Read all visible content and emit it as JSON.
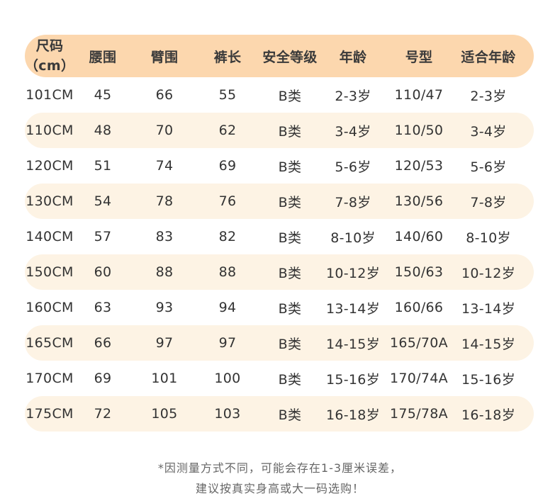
{
  "header": {
    "size_line1": "尺码",
    "size_line2": "（cm）",
    "waist": "腰围",
    "arm": "臂围",
    "pants_length": "裤长",
    "safety_level": "安全等级",
    "age": "年龄",
    "model": "号型",
    "suitable_age": "适合年龄"
  },
  "rows": [
    {
      "size": "101CM",
      "waist": "45",
      "arm": "66",
      "pants": "55",
      "level": "B类",
      "age": "2-3岁",
      "model": "110/47",
      "suit": "2-3岁"
    },
    {
      "size": "110CM",
      "waist": "48",
      "arm": "70",
      "pants": "62",
      "level": "B类",
      "age": "3-4岁",
      "model": "110/50",
      "suit": "3-4岁"
    },
    {
      "size": "120CM",
      "waist": "51",
      "arm": "74",
      "pants": "69",
      "level": "B类",
      "age": "5-6岁",
      "model": "120/53",
      "suit": "5-6岁"
    },
    {
      "size": "130CM",
      "waist": "54",
      "arm": "78",
      "pants": "76",
      "level": "B类",
      "age": "7-8岁",
      "model": "130/56",
      "suit": "7-8岁"
    },
    {
      "size": "140CM",
      "waist": "57",
      "arm": "83",
      "pants": "82",
      "level": "B类",
      "age": "8-10岁",
      "model": "140/60",
      "suit": "8-10岁"
    },
    {
      "size": "150CM",
      "waist": "60",
      "arm": "88",
      "pants": "88",
      "level": "B类",
      "age": "10-12岁",
      "model": "150/63",
      "suit": "10-12岁"
    },
    {
      "size": "160CM",
      "waist": "63",
      "arm": "93",
      "pants": "94",
      "level": "B类",
      "age": "13-14岁",
      "model": "160/66",
      "suit": "13-14岁"
    },
    {
      "size": "165CM",
      "waist": "66",
      "arm": "97",
      "pants": "97",
      "level": "B类",
      "age": "14-15岁",
      "model": "165/70A",
      "suit": "14-15岁"
    },
    {
      "size": "170CM",
      "waist": "69",
      "arm": "101",
      "pants": "100",
      "level": "B类",
      "age": "15-16岁",
      "model": "170/74A",
      "suit": "15-16岁"
    },
    {
      "size": "175CM",
      "waist": "72",
      "arm": "105",
      "pants": "103",
      "level": "B类",
      "age": "16-18岁",
      "model": "175/78A",
      "suit": "16-18岁"
    }
  ],
  "footnote": {
    "line1": "*因测量方式不同，可能会存在1-3厘米误差，",
    "line2": "建议按真实身高或大一码选购！"
  },
  "colors": {
    "header_bg": "#fcd7ae",
    "stripe_bg": "#fdf3e4",
    "text": "#333333"
  }
}
